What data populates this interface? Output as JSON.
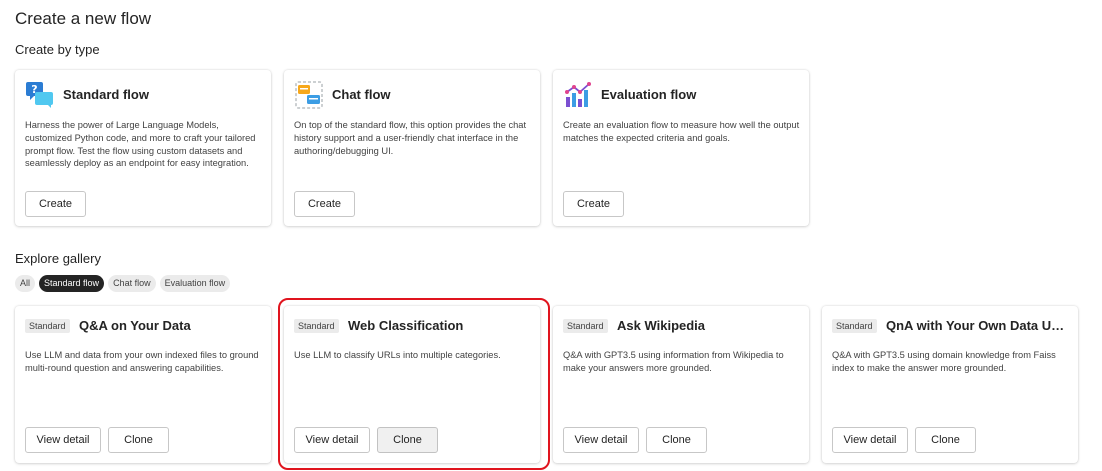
{
  "page_title": "Create a new flow",
  "create_by_type": {
    "heading": "Create by type",
    "cards": [
      {
        "icon": "standard-flow-icon",
        "title": "Standard flow",
        "description": "Harness the power of Large Language Models, customized Python code, and more to craft your tailored prompt flow. Test the flow using custom datasets and seamlessly deploy as an endpoint for easy integration.",
        "button": "Create"
      },
      {
        "icon": "chat-flow-icon",
        "title": "Chat flow",
        "description": "On top of the standard flow, this option provides the chat history support and a user-friendly chat interface in the authoring/debugging UI.",
        "button": "Create"
      },
      {
        "icon": "evaluation-flow-icon",
        "title": "Evaluation flow",
        "description": "Create an evaluation flow to measure how well the output matches the expected criteria and goals.",
        "button": "Create"
      }
    ]
  },
  "gallery": {
    "heading": "Explore gallery",
    "filters": [
      "All",
      "Standard flow",
      "Chat flow",
      "Evaluation flow"
    ],
    "active_filter": "Standard flow",
    "cards": [
      {
        "tag": "Standard",
        "title": "Q&A on Your Data",
        "description": "Use LLM and data from your own indexed files to ground multi-round question and answering capabilities.",
        "view_label": "View detail",
        "clone_label": "Clone"
      },
      {
        "tag": "Standard",
        "title": "Web Classification",
        "description": "Use LLM to classify URLs into multiple categories.",
        "view_label": "View detail",
        "clone_label": "Clone"
      },
      {
        "tag": "Standard",
        "title": "Ask Wikipedia",
        "description": "Q&A with GPT3.5 using information from Wikipedia to make your answers more grounded.",
        "view_label": "View detail",
        "clone_label": "Clone"
      },
      {
        "tag": "Standard",
        "title": "QnA with Your Own Data Using Faiss Index",
        "description": "Q&A with GPT3.5 using domain knowledge from Faiss index to make the answer more grounded.",
        "view_label": "View detail",
        "clone_label": "Clone"
      }
    ]
  },
  "colors": {
    "highlight": "#e0141e",
    "chip_active": "#242424",
    "chip_default": "#ebebeb"
  }
}
